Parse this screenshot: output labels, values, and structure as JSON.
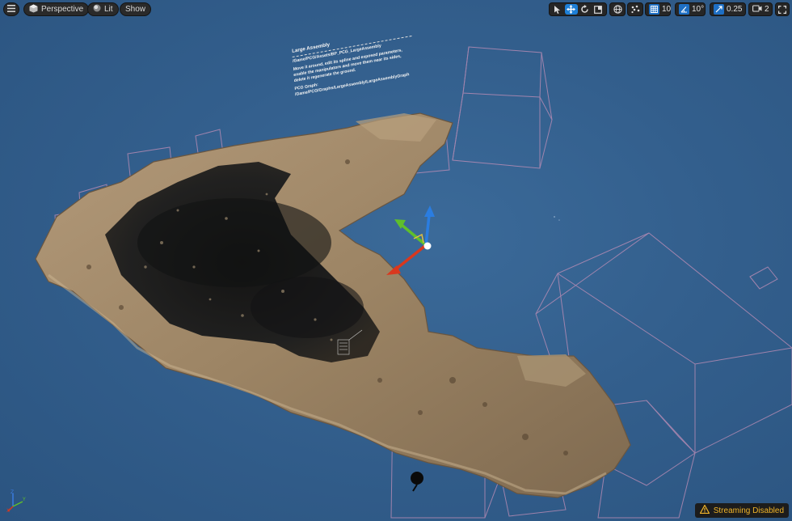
{
  "toolbar": {
    "perspective_label": "Perspective",
    "lit_label": "Lit",
    "show_label": "Show",
    "grid_snap_value": "10",
    "rotation_snap_value": "10°",
    "scale_snap_value": "0.25",
    "camera_speed_value": "2"
  },
  "annotation": {
    "title": "Large Assembly",
    "path": "/Game/PCG/Assets/BP_PCG_LargeAssembly",
    "body": "Move it around, edit its spline and exposed parameters, enable the manipulators and move them near its sides, delete it regenerate the ground.",
    "graph_label": "PCG Graph:",
    "graph_path": "/Game/PCG/Graphs/LargeAssembly/LargeAssemblyGraph"
  },
  "status": {
    "streaming": "Streaming Disabled"
  },
  "colors": {
    "viewport_bg": "#335f8d",
    "wireframe": "#c490b8",
    "gizmo_x": "#d9381e",
    "gizmo_y": "#5fbf2b",
    "gizmo_z": "#2a7de1",
    "accent": "#1e7fd6",
    "warning": "#f0b429"
  }
}
